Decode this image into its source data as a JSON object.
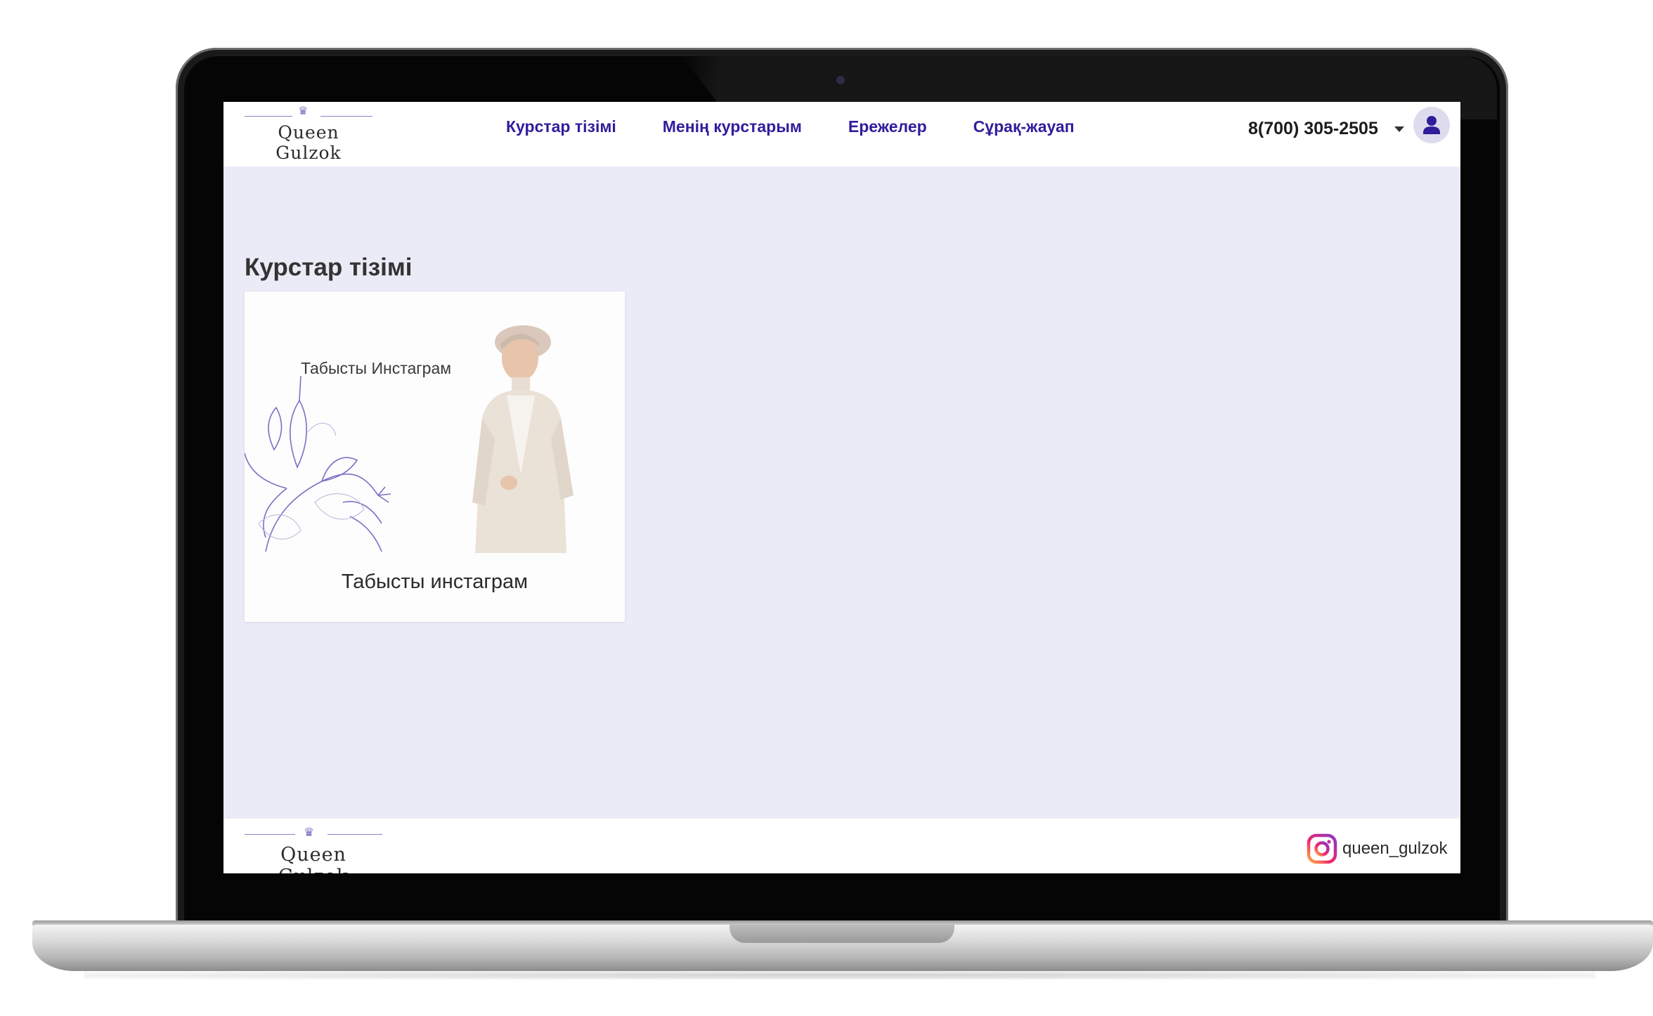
{
  "brand": {
    "name": "Queen Gulzok"
  },
  "nav": {
    "items": [
      {
        "label": "Курстар тізімі"
      },
      {
        "label": "Менің курстарым"
      },
      {
        "label": "Ережелер"
      },
      {
        "label": "Сұрақ-жауап"
      }
    ]
  },
  "header": {
    "phone": "8(700) 305-2505"
  },
  "main": {
    "title": "Курстар тізімі",
    "courses": [
      {
        "image_caption": "Табысты Инстаграм",
        "title": "Табысты инстаграм"
      }
    ]
  },
  "footer": {
    "brand": "Queen Gulzok",
    "instagram_handle": "queen_gulzok"
  },
  "colors": {
    "accent": "#2f1d9c",
    "background": "#ebebf7",
    "lily": "#7b6fc4"
  },
  "icons": [
    "crown-icon",
    "caret-down-icon",
    "user-icon",
    "instagram-icon"
  ]
}
